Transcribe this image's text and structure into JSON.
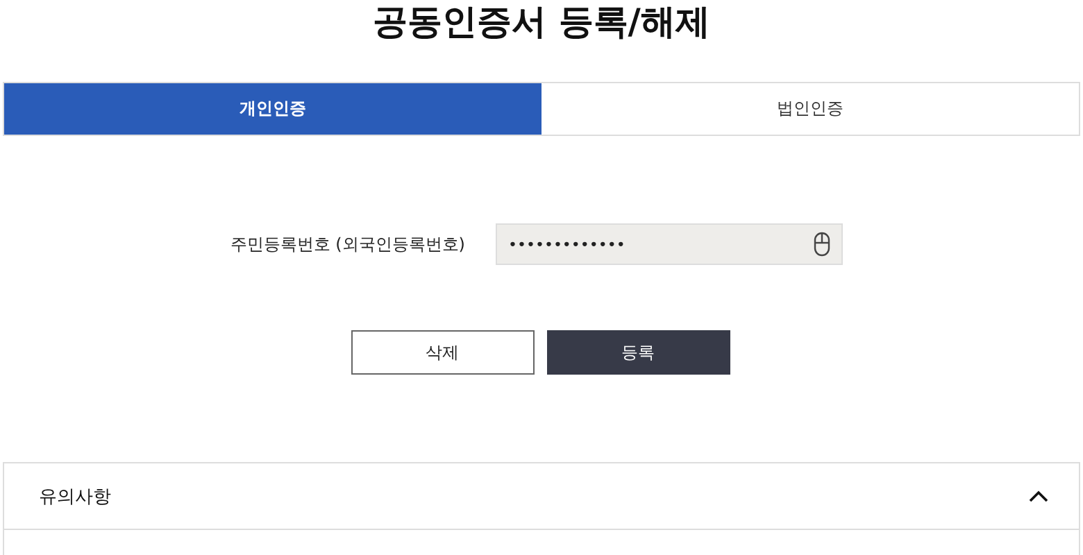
{
  "title": "공동인증서 등록/해제",
  "tabs": [
    {
      "label": "개인인증",
      "selected": true
    },
    {
      "label": "법인인증",
      "selected": false
    }
  ],
  "field": {
    "label": "주민등록번호 (외국인등록번호)",
    "value": "•••••••••••••"
  },
  "buttons": [
    {
      "label": "삭제",
      "kind": "secondary"
    },
    {
      "label": "등록",
      "kind": "primary"
    }
  ],
  "notice": {
    "title": "유의사항",
    "expanded": true
  }
}
